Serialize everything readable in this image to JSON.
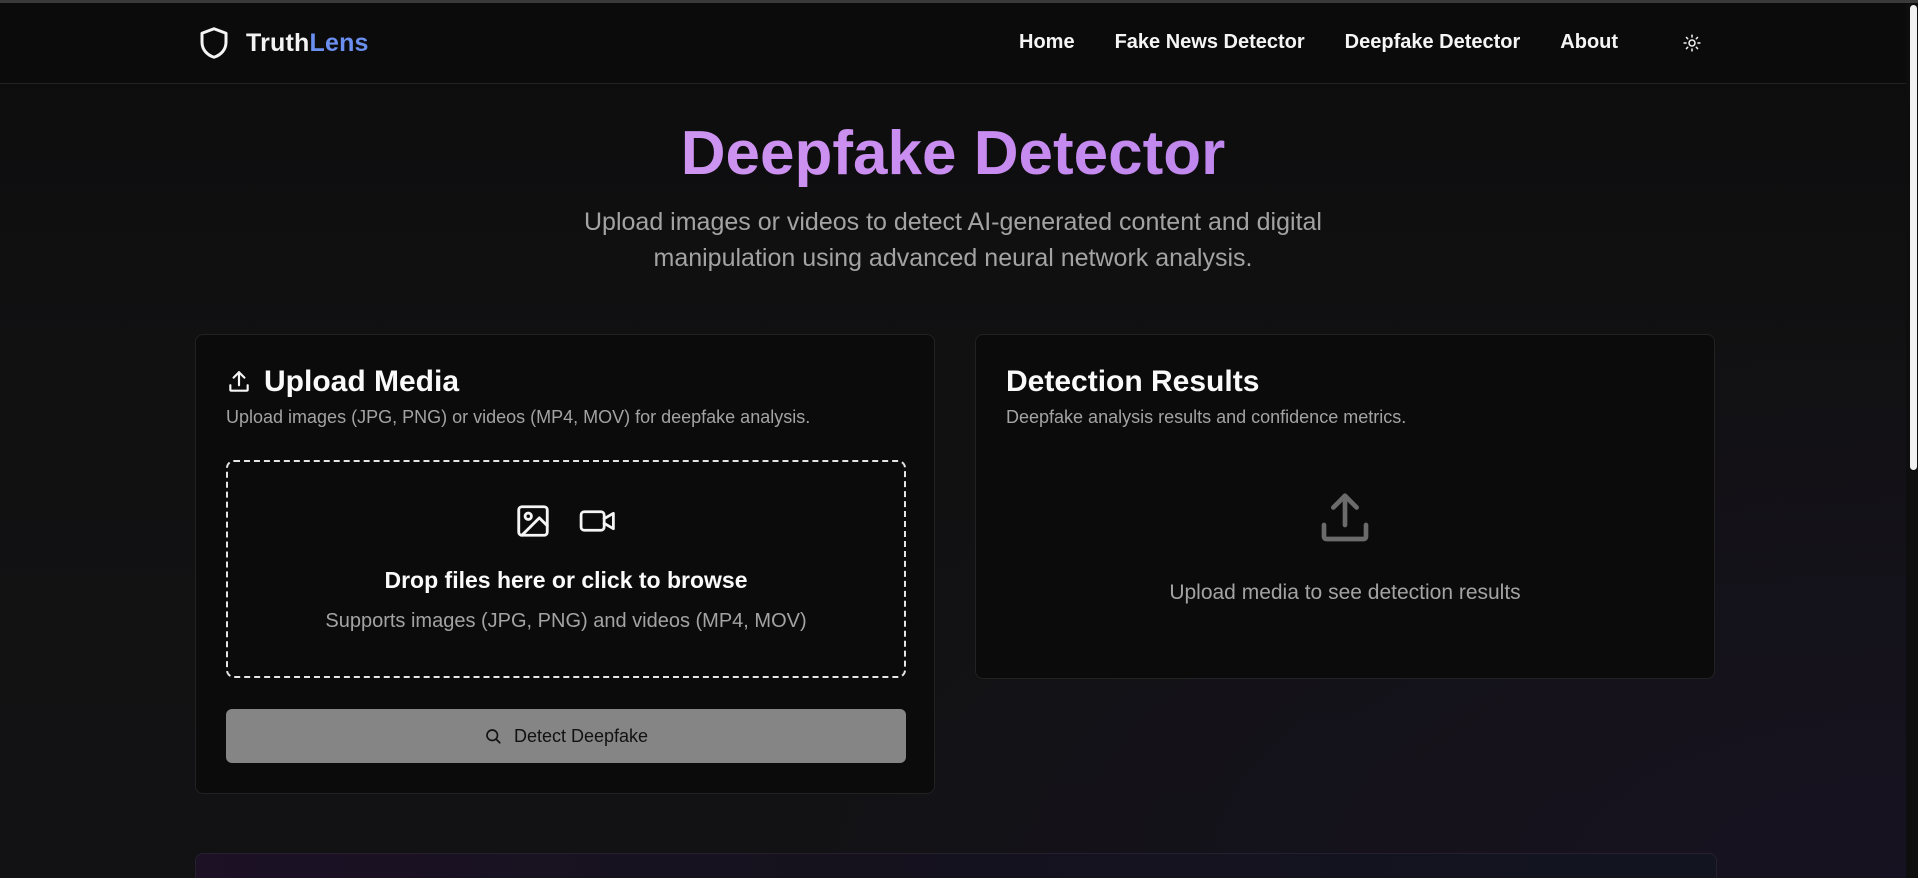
{
  "header": {
    "brand_part1": "Truth",
    "brand_part2": "Lens",
    "nav": [
      "Home",
      "Fake News Detector",
      "Deepfake Detector",
      "About"
    ],
    "logo_icon": "shield-icon",
    "theme_icon": "sun-icon"
  },
  "hero": {
    "title": "Deepfake Detector",
    "subtitle": "Upload images or videos to detect AI-generated content and digital manipulation using advanced neural network analysis."
  },
  "upload_card": {
    "title": "Upload Media",
    "description": "Upload images (JPG, PNG) or videos (MP4, MOV) for deepfake analysis.",
    "dropzone_title": "Drop files here or click to browse",
    "dropzone_subtitle": "Supports images (JPG, PNG) and videos (MP4, MOV)",
    "button_label": "Detect Deepfake",
    "icons": [
      "upload-icon",
      "image-icon",
      "video-icon",
      "search-icon"
    ]
  },
  "results_card": {
    "title": "Detection Results",
    "description": "Deepfake analysis results and confidence metrics.",
    "empty_message": "Upload media to see detection results",
    "icon": "upload-icon"
  },
  "colors": {
    "background": "#0b0b0c",
    "brand_accent": "#6b8ff0",
    "title_gradient_start": "#d9a8f2",
    "title_gradient_end": "#a77de8",
    "button_disabled": "#858585"
  }
}
